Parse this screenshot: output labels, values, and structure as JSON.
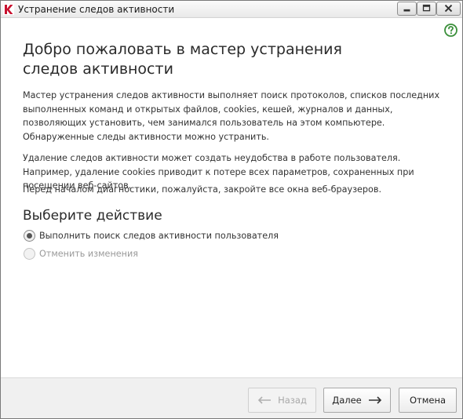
{
  "window": {
    "title": "Устранение следов активности",
    "accent_color": "#3a8f3a"
  },
  "titlebar": {
    "app_icon": "kaspersky-k-icon",
    "buttons": [
      "minimize-icon",
      "maximize-icon",
      "close-icon"
    ]
  },
  "help": {
    "icon": "help-question-icon"
  },
  "main": {
    "title": "Добро пожаловать в мастер устранения следов активности",
    "paragraph1": "Мастер устранения следов активности выполняет поиск протоколов, списков последних выполненных команд и открытых файлов, cookies, кешей, журналов и данных, позволяющих установить, чем занимался пользователь на этом компьютере. Обнаруженные следы активности можно устранить.",
    "paragraph2": "Удаление следов активности может создать неудобства в работе пользователя. Например, удаление cookies приводит к потере всех параметров, сохраненных при посещении веб-сайтов.",
    "paragraph3": "Перед началом диагностики, пожалуйста, закройте все окна веб-браузеров.",
    "section_title": "Выберите действие",
    "options": [
      {
        "label": "Выполнить поиск следов активности пользователя",
        "selected": true,
        "enabled": true
      },
      {
        "label": "Отменить изменения",
        "selected": false,
        "enabled": false
      }
    ]
  },
  "footer": {
    "back_label": "Назад",
    "next_label": "Далее",
    "cancel_label": "Отмена",
    "back_enabled": false
  }
}
